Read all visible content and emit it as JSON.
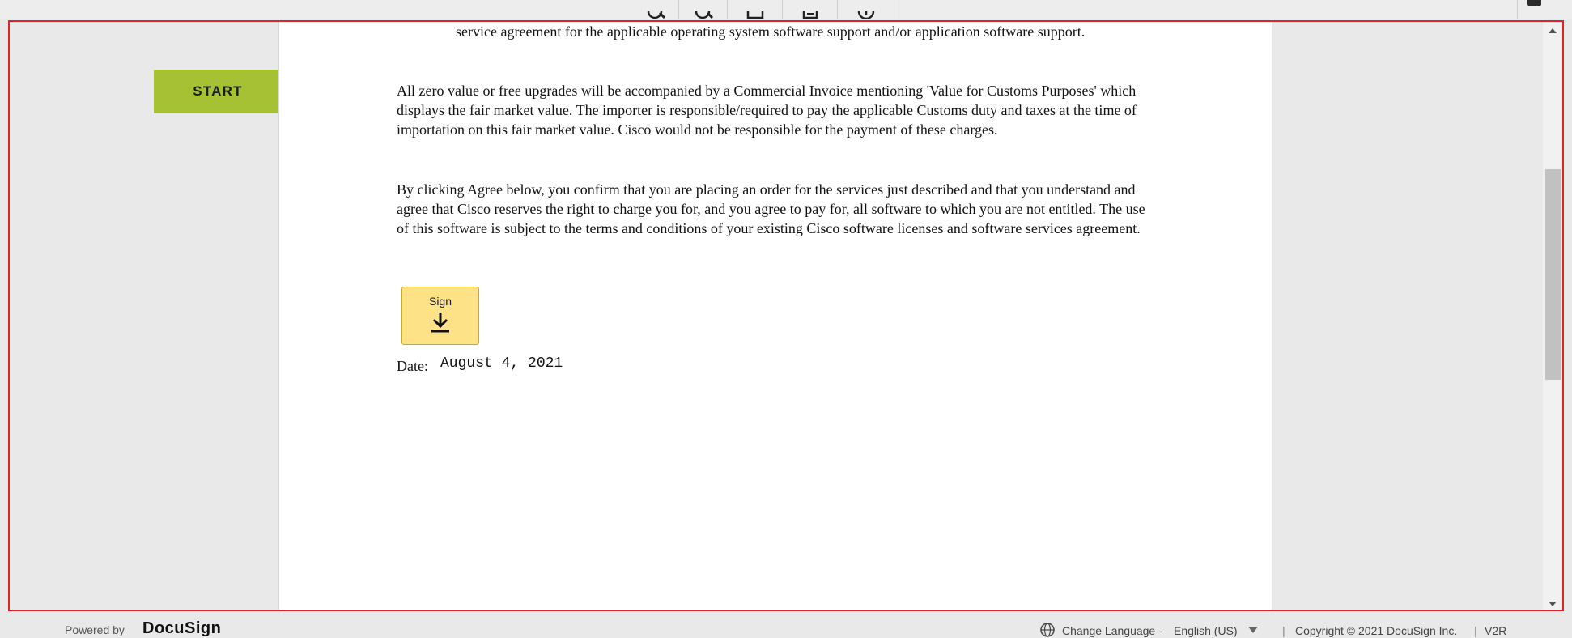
{
  "toolbar": {
    "icons": [
      "zoom-in-icon",
      "zoom-out-icon",
      "download-icon",
      "print-icon",
      "info-icon"
    ]
  },
  "navigation": {
    "start_label": "START"
  },
  "document": {
    "paragraph_top": "service agreement for the applicable operating system software support and/or application software support.",
    "paragraph_1": "All zero value or free upgrades will be accompanied by a Commercial Invoice mentioning 'Value for Customs Purposes' which displays the fair market value. The importer is responsible/required to pay the applicable Customs duty and taxes at the time of importation on this fair market value. Cisco would not be responsible for the payment of these charges.",
    "paragraph_2": "By clicking Agree below, you confirm that you are placing an order for the services just described and that you understand and agree that Cisco reserves the right to charge you for, and you agree to pay for, all software to which you are not entitled. The use of this software is subject to the terms and conditions of your existing Cisco software licenses and software services agreement.",
    "sign_label": "Sign",
    "date_label": "Date:",
    "date_value": "August 4, 2021"
  },
  "footer": {
    "powered_by": "Powered by",
    "brand": "DocuSign",
    "change_language": "Change Language -",
    "language_value": "English (US)",
    "copyright": "Copyright © 2021 DocuSign Inc.",
    "version": "V2R"
  },
  "colors": {
    "start_button": "#a7c135",
    "sign_tag": "#fde287",
    "frame_border": "#e0232b"
  }
}
